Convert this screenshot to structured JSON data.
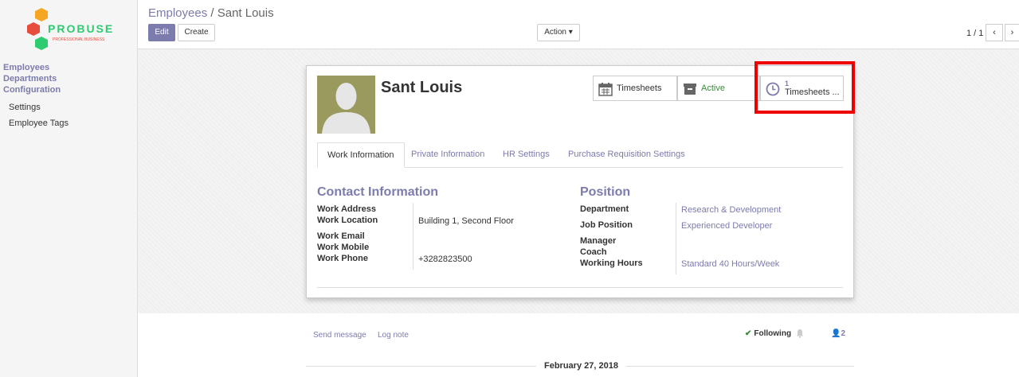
{
  "brand": {
    "name": "PROBUSE",
    "tagline": "PROFESSIONAL BUSINESS"
  },
  "sidebar": {
    "menu": [
      "Employees",
      "Departments",
      "Configuration"
    ],
    "submenu": [
      "Settings",
      "Employee Tags"
    ]
  },
  "breadcrumb": {
    "parent": "Employees",
    "separator": "/",
    "current": "Sant Louis"
  },
  "toolbar": {
    "edit_label": "Edit",
    "create_label": "Create",
    "action_label": "Action"
  },
  "pager": {
    "value": "1 / 1",
    "prev_icon": "chevron-left-icon",
    "next_icon": "chevron-right-icon"
  },
  "employee": {
    "name": "Sant Louis"
  },
  "smart_buttons": {
    "timesheets": "Timesheets",
    "active": "Active",
    "timesheets_count": "1",
    "timesheets_count_label": "Timesheets ..."
  },
  "tabs": [
    "Work Information",
    "Private Information",
    "HR Settings",
    "Purchase Requisition Settings"
  ],
  "contact": {
    "title": "Contact Information",
    "work_address_label": "Work Address",
    "work_location_label": "Work Location",
    "work_location_value": "Building 1, Second Floor",
    "work_email_label": "Work Email",
    "work_mobile_label": "Work Mobile",
    "work_phone_label": "Work Phone",
    "work_phone_value": "+3282823500"
  },
  "position": {
    "title": "Position",
    "department_label": "Department",
    "department_value": "Research & Development",
    "job_label": "Job Position",
    "job_value": "Experienced Developer",
    "manager_label": "Manager",
    "coach_label": "Coach",
    "hours_label": "Working Hours",
    "hours_value": "Standard 40 Hours/Week"
  },
  "chatter": {
    "send_message": "Send message",
    "log_note": "Log note",
    "following": "Following",
    "followers_count": "2",
    "date": "February 27, 2018"
  },
  "colors": {
    "accent": "#7c7bad",
    "highlight": "#e00000",
    "active_green": "#3c8a3c"
  }
}
